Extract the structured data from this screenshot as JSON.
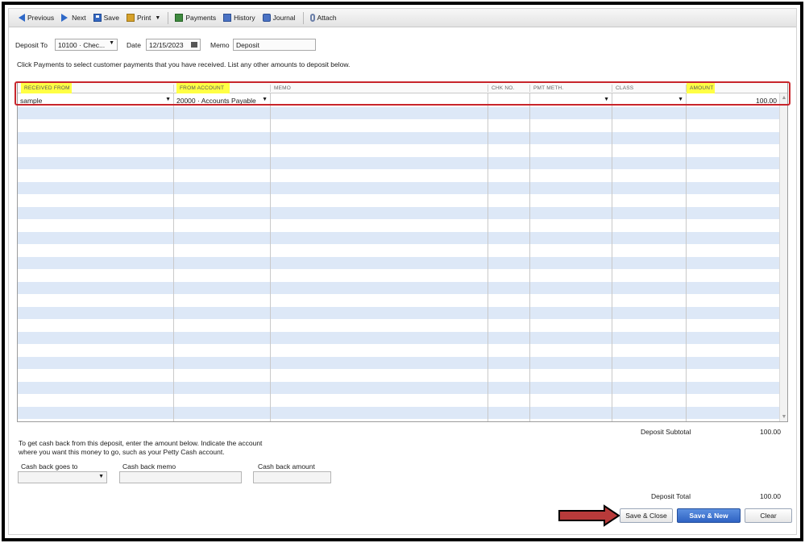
{
  "toolbar": {
    "previous": "Previous",
    "next": "Next",
    "save": "Save",
    "print": "Print",
    "payments": "Payments",
    "history": "History",
    "journal": "Journal",
    "attach": "Attach"
  },
  "header": {
    "deposit_to_label": "Deposit To",
    "deposit_to_value": "10100 · Chec...",
    "date_label": "Date",
    "date_value": "12/15/2023",
    "memo_label": "Memo",
    "memo_value": "Deposit",
    "instructions": "Click Payments to select customer payments that you have received. List any other amounts to deposit below."
  },
  "grid": {
    "columns": [
      "RECEIVED FROM",
      "FROM ACCOUNT",
      "MEMO",
      "CHK NO.",
      "PMT METH.",
      "CLASS",
      "AMOUNT"
    ],
    "rows": [
      {
        "received_from": "sample",
        "from_account": "20000 · Accounts Payable",
        "memo": "",
        "chk_no": "",
        "pmt_meth": "",
        "class": "",
        "amount": "100.00"
      }
    ]
  },
  "summary": {
    "subtotal_label": "Deposit Subtotal",
    "subtotal_value": "100.00",
    "total_label": "Deposit Total",
    "total_value": "100.00"
  },
  "cashback": {
    "note": "To get cash back from this deposit, enter the amount below.  Indicate the account where you want this money to go, such as your Petty Cash account.",
    "goes_to_label": "Cash back goes to",
    "memo_label": "Cash back memo",
    "amount_label": "Cash back amount"
  },
  "buttons": {
    "save_close": "Save & Close",
    "save_new": "Save & New",
    "clear": "Clear"
  },
  "colors": {
    "row_stripe": "#dde8f7",
    "highlight_yellow": "#ffff44",
    "annotation_red": "#c8252b",
    "primary_button": "#2f63c3"
  }
}
